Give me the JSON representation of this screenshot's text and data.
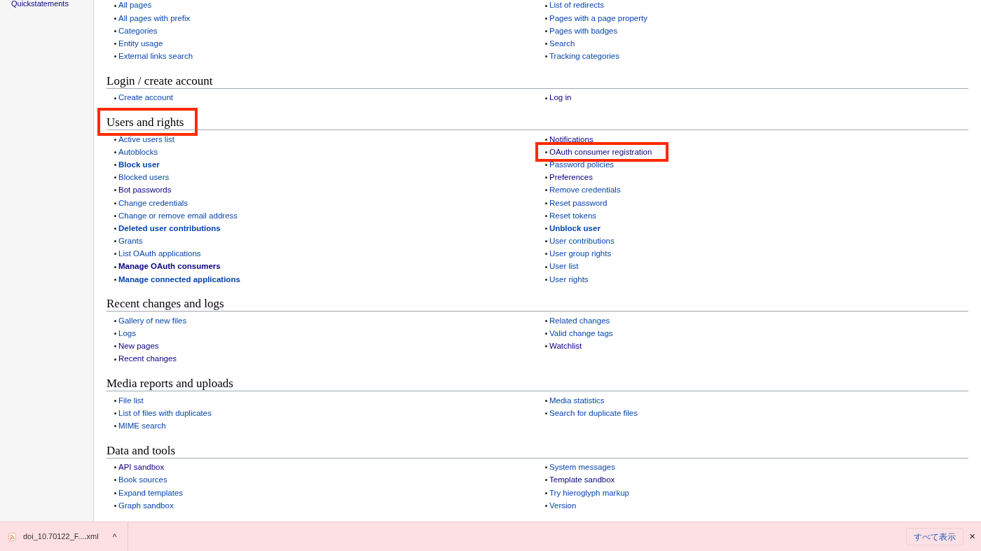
{
  "sidebar": {
    "items": [
      {
        "label": "Quickstatements"
      }
    ]
  },
  "sections": [
    {
      "left": [
        {
          "label": "All pages",
          "bold": false,
          "visited": false
        },
        {
          "label": "All pages with prefix",
          "bold": false,
          "visited": false
        },
        {
          "label": "Categories",
          "bold": false,
          "visited": false
        },
        {
          "label": "Entity usage",
          "bold": false,
          "visited": false
        },
        {
          "label": "External links search",
          "bold": false,
          "visited": false
        }
      ],
      "right": [
        {
          "label": "List of redirects",
          "bold": false,
          "visited": false
        },
        {
          "label": "Pages with a page property",
          "bold": false,
          "visited": false
        },
        {
          "label": "Pages with badges",
          "bold": false,
          "visited": false
        },
        {
          "label": "Search",
          "bold": false,
          "visited": false
        },
        {
          "label": "Tracking categories",
          "bold": false,
          "visited": false
        }
      ]
    },
    {
      "heading": "Login / create account",
      "left": [
        {
          "label": "Create account",
          "bold": false,
          "visited": false
        }
      ],
      "right": [
        {
          "label": "Log in",
          "bold": false,
          "visited": true
        }
      ]
    },
    {
      "heading": "Users and rights",
      "highlighted": true,
      "left": [
        {
          "label": "Active users list",
          "bold": false,
          "visited": false
        },
        {
          "label": "Autoblocks",
          "bold": false,
          "visited": false
        },
        {
          "label": "Block user",
          "bold": true,
          "visited": false
        },
        {
          "label": "Blocked users",
          "bold": false,
          "visited": false
        },
        {
          "label": "Bot passwords",
          "bold": false,
          "visited": true
        },
        {
          "label": "Change credentials",
          "bold": false,
          "visited": false
        },
        {
          "label": "Change or remove email address",
          "bold": false,
          "visited": false
        },
        {
          "label": "Deleted user contributions",
          "bold": true,
          "visited": false
        },
        {
          "label": "Grants",
          "bold": false,
          "visited": false
        },
        {
          "label": "List OAuth applications",
          "bold": false,
          "visited": false
        },
        {
          "label": "Manage OAuth consumers",
          "bold": true,
          "visited": true
        },
        {
          "label": "Manage connected applications",
          "bold": true,
          "visited": false
        }
      ],
      "right": [
        {
          "label": "Notifications",
          "bold": false,
          "visited": true
        },
        {
          "label": "OAuth consumer registration",
          "bold": false,
          "visited": true,
          "highlighted": true
        },
        {
          "label": "Password policies",
          "bold": false,
          "visited": false
        },
        {
          "label": "Preferences",
          "bold": false,
          "visited": true
        },
        {
          "label": "Remove credentials",
          "bold": false,
          "visited": false
        },
        {
          "label": "Reset password",
          "bold": false,
          "visited": false
        },
        {
          "label": "Reset tokens",
          "bold": false,
          "visited": false
        },
        {
          "label": "Unblock user",
          "bold": true,
          "visited": false
        },
        {
          "label": "User contributions",
          "bold": false,
          "visited": false
        },
        {
          "label": "User group rights",
          "bold": false,
          "visited": false
        },
        {
          "label": "User list",
          "bold": false,
          "visited": false
        },
        {
          "label": "User rights",
          "bold": false,
          "visited": false
        }
      ]
    },
    {
      "heading": "Recent changes and logs",
      "left": [
        {
          "label": "Gallery of new files",
          "bold": false,
          "visited": false
        },
        {
          "label": "Logs",
          "bold": false,
          "visited": false
        },
        {
          "label": "New pages",
          "bold": false,
          "visited": true
        },
        {
          "label": "Recent changes",
          "bold": false,
          "visited": true
        }
      ],
      "right": [
        {
          "label": "Related changes",
          "bold": false,
          "visited": false
        },
        {
          "label": "Valid change tags",
          "bold": false,
          "visited": false
        },
        {
          "label": "Watchlist",
          "bold": false,
          "visited": true
        }
      ]
    },
    {
      "heading": "Media reports and uploads",
      "left": [
        {
          "label": "File list",
          "bold": false,
          "visited": false
        },
        {
          "label": "List of files with duplicates",
          "bold": false,
          "visited": false
        },
        {
          "label": "MIME search",
          "bold": false,
          "visited": false
        }
      ],
      "right": [
        {
          "label": "Media statistics",
          "bold": false,
          "visited": false
        },
        {
          "label": "Search for duplicate files",
          "bold": false,
          "visited": false
        }
      ]
    },
    {
      "heading": "Data and tools",
      "left": [
        {
          "label": "API sandbox",
          "bold": false,
          "visited": true
        },
        {
          "label": "Book sources",
          "bold": false,
          "visited": false
        },
        {
          "label": "Expand templates",
          "bold": false,
          "visited": false
        },
        {
          "label": "Graph sandbox",
          "bold": false,
          "visited": false
        }
      ],
      "right": [
        {
          "label": "System messages",
          "bold": false,
          "visited": false
        },
        {
          "label": "Template sandbox",
          "bold": false,
          "visited": true
        },
        {
          "label": "Try hieroglyph markup",
          "bold": false,
          "visited": false
        },
        {
          "label": "Version",
          "bold": false,
          "visited": false
        }
      ]
    }
  ],
  "download_bar": {
    "file": "doi_10.70122_F....xml",
    "caret": "^",
    "show_all": "すべて表示",
    "close": "×"
  }
}
